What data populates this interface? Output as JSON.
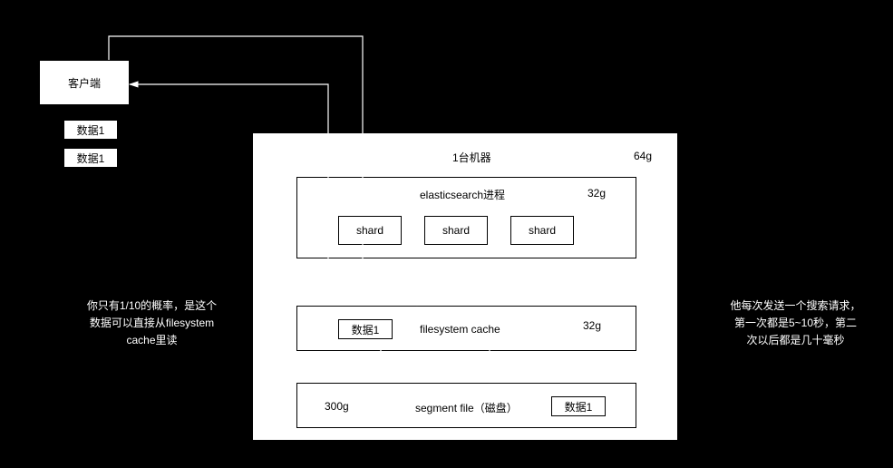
{
  "client": {
    "label": "客户端"
  },
  "dataItems": {
    "d1": "数据1",
    "d2": "数据1"
  },
  "machine": {
    "title": "1台机器",
    "mem": "64g"
  },
  "esProcess": {
    "title": "elasticsearch进程",
    "mem": "32g"
  },
  "shards": {
    "s1": "shard",
    "s2": "shard",
    "s3": "shard"
  },
  "fsCache": {
    "title": "filesystem cache",
    "mem": "32g",
    "data": "数据1"
  },
  "segment": {
    "prefix": "300g",
    "title": "segment file（磁盘）",
    "data": "数据1"
  },
  "noteLeft": {
    "l1": "你只有1/10的概率，是这个",
    "l2": "数据可以直接从filesystem",
    "l3": "cache里读"
  },
  "noteRight": {
    "l1": "他每次发送一个搜索请求，",
    "l2": "第一次都是5~10秒，第二",
    "l3": "次以后都是几十毫秒"
  }
}
